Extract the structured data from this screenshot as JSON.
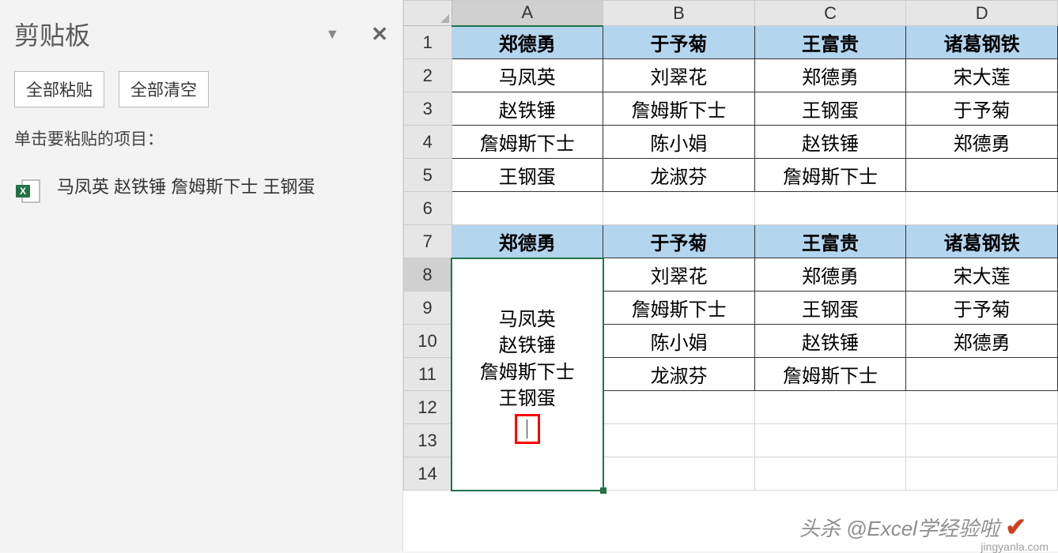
{
  "clipboard": {
    "title": "剪贴板",
    "paste_all": "全部粘贴",
    "clear_all": "全部清空",
    "hint": "单击要粘贴的项目：",
    "items": [
      {
        "text": "马凤英 赵铁锤 詹姆斯下士 王钢蛋"
      }
    ]
  },
  "columns": [
    "A",
    "B",
    "C",
    "D"
  ],
  "rows": [
    "1",
    "2",
    "3",
    "4",
    "5",
    "6",
    "7",
    "8",
    "9",
    "10",
    "11",
    "12",
    "13",
    "14"
  ],
  "active_cell": "A8",
  "chart_data": {
    "type": "table",
    "grid": [
      [
        "郑德勇",
        "于予菊",
        "王富贵",
        "诸葛钢铁"
      ],
      [
        "马凤英",
        "刘翠花",
        "郑德勇",
        "宋大莲"
      ],
      [
        "赵铁锤",
        "詹姆斯下士",
        "王钢蛋",
        "于予菊"
      ],
      [
        "詹姆斯下士",
        "陈小娟",
        "赵铁锤",
        "郑德勇"
      ],
      [
        "王钢蛋",
        "龙淑芬",
        "詹姆斯下士",
        ""
      ],
      [
        "",
        "",
        "",
        ""
      ],
      [
        "郑德勇",
        "于予菊",
        "王富贵",
        "诸葛钢铁"
      ],
      [
        "",
        "刘翠花",
        "郑德勇",
        "宋大莲"
      ],
      [
        "",
        "詹姆斯下士",
        "王钢蛋",
        "于予菊"
      ],
      [
        "",
        "陈小娟",
        "赵铁锤",
        "郑德勇"
      ],
      [
        "",
        "龙淑芬",
        "詹姆斯下士",
        ""
      ],
      [
        "",
        "",
        "",
        ""
      ],
      [
        "",
        "",
        "",
        ""
      ],
      [
        "",
        "",
        "",
        ""
      ]
    ],
    "editing_cell_content": [
      "马凤英",
      "赵铁锤",
      "詹姆斯下士",
      "王钢蛋"
    ]
  },
  "watermark": "头杀 @Excel学经验啦",
  "watermark_site": "jingyanla.com"
}
